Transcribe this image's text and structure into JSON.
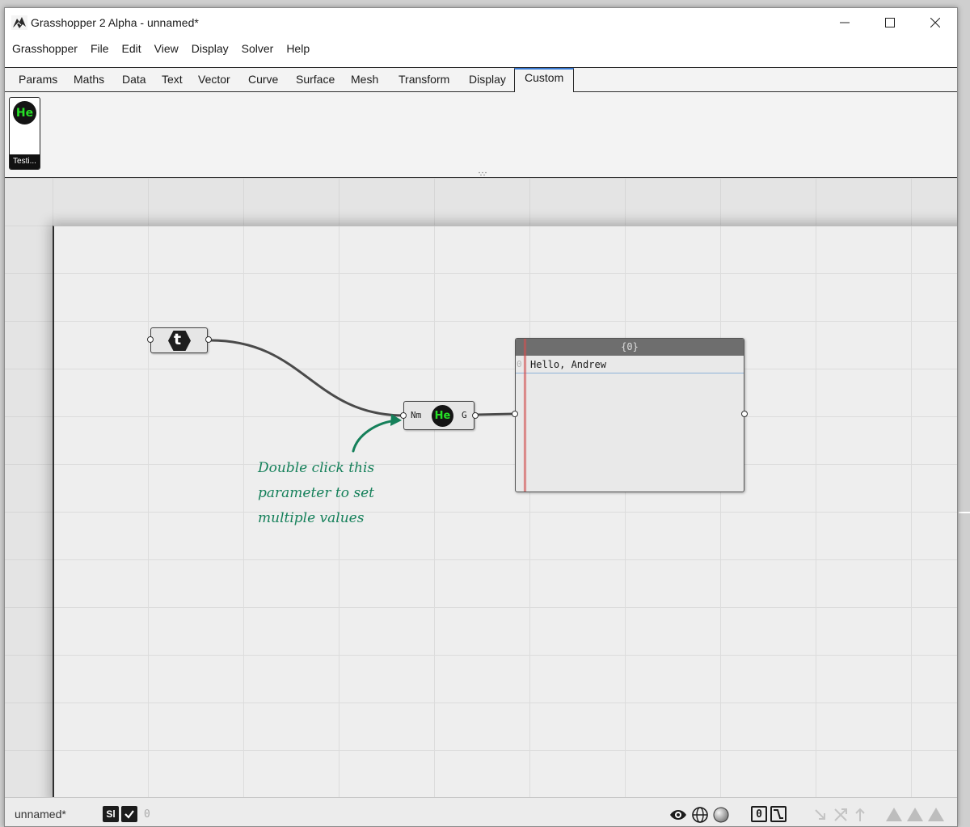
{
  "window": {
    "title": "Grasshopper 2 Alpha - unnamed*"
  },
  "menu": {
    "items": [
      "Grasshopper",
      "File",
      "Edit",
      "View",
      "Display",
      "Solver",
      "Help"
    ]
  },
  "tabs": {
    "items": [
      "Params",
      "Maths",
      "Data",
      "Text",
      "Vector",
      "Curve",
      "Surface",
      "Mesh",
      "Transform",
      "Display",
      "Custom"
    ],
    "active": "Custom"
  },
  "ribbon": {
    "component_badge": "He",
    "component_label": "Testi..."
  },
  "canvas": {
    "text_param_glyph": "t",
    "hello_component": {
      "input_label": "Nm",
      "badge": "He",
      "output_label": "G"
    },
    "panel": {
      "path": "{0}",
      "index": "0",
      "value": "Hello, Andrew"
    },
    "annotation": [
      "Double click this",
      "parameter to set",
      "multiple values"
    ]
  },
  "statusbar": {
    "document": "unnamed*",
    "sl_label": "Sl",
    "count": "0",
    "zero_toggle": "0"
  },
  "colors": {
    "accent_tab": "#3a7bd5",
    "annotation": "#15805a",
    "badge_text": "#26e026",
    "wire": "#4a4a4a"
  },
  "icons": [
    "app-logo-icon",
    "minimize-icon",
    "maximize-icon",
    "close-icon",
    "text-hexagon-icon",
    "eye-icon",
    "globe-icon",
    "sphere-icon",
    "graph-icon",
    "arrow-icons",
    "triangle-icons"
  ]
}
